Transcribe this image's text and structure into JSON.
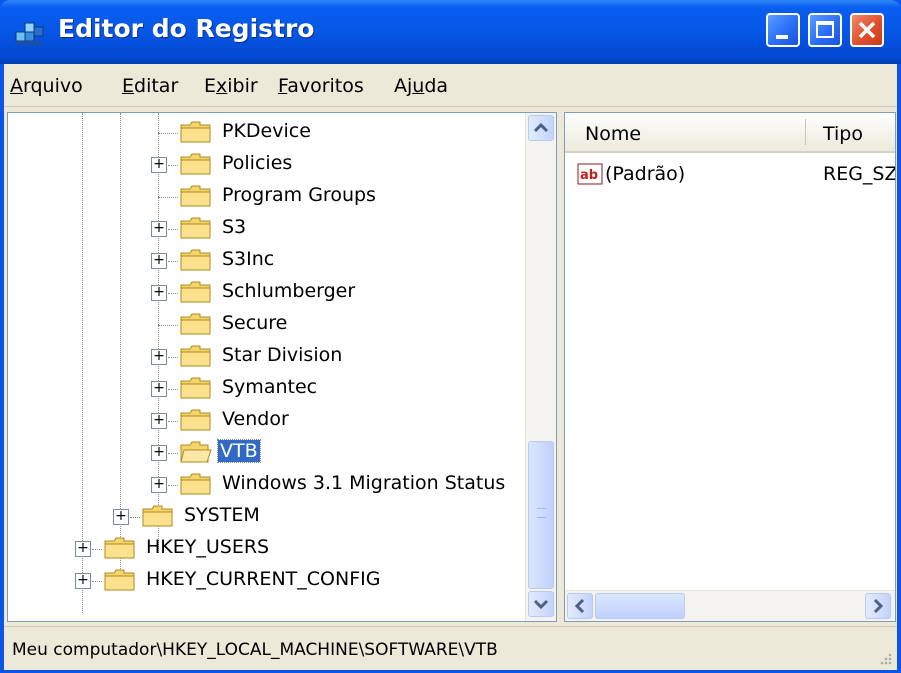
{
  "window": {
    "title": "Editor do Registro"
  },
  "menu": [
    {
      "pre": "",
      "u": "A",
      "post": "rquivo"
    },
    {
      "pre": "",
      "u": "E",
      "post": "ditar"
    },
    {
      "pre": "E",
      "u": "x",
      "post": "ibir"
    },
    {
      "pre": "",
      "u": "F",
      "post": "avoritos"
    },
    {
      "pre": "Aj",
      "u": "u",
      "post": "da"
    }
  ],
  "tree": [
    {
      "label": "PKDevice",
      "expandable": false
    },
    {
      "label": "Policies",
      "expandable": true
    },
    {
      "label": "Program Groups",
      "expandable": false
    },
    {
      "label": "S3",
      "expandable": true
    },
    {
      "label": "S3Inc",
      "expandable": true
    },
    {
      "label": "Schlumberger",
      "expandable": true
    },
    {
      "label": "Secure",
      "expandable": false
    },
    {
      "label": "Star Division",
      "expandable": true
    },
    {
      "label": "Symantec",
      "expandable": true
    },
    {
      "label": "Vendor",
      "expandable": true
    },
    {
      "label": "VTB",
      "expandable": true,
      "selected": true
    },
    {
      "label": "Windows 3.1 Migration Status",
      "expandable": true
    },
    {
      "label": "SYSTEM",
      "expandable": true
    },
    {
      "label": "HKEY_USERS",
      "expandable": true
    },
    {
      "label": "HKEY_CURRENT_CONFIG",
      "expandable": true
    }
  ],
  "list": {
    "columns": [
      "Nome",
      "Tipo"
    ],
    "rows": [
      {
        "name": "(Padrão)",
        "type": "REG_SZ",
        "icon": "string-value-icon"
      }
    ]
  },
  "status": {
    "path": "Meu computador\\HKEY_LOCAL_MACHINE\\SOFTWARE\\VTB"
  },
  "colors": {
    "titlebar": "#0556e4",
    "selection": "#316ac5",
    "chrome": "#ece9d8",
    "close": "#e0502e"
  }
}
